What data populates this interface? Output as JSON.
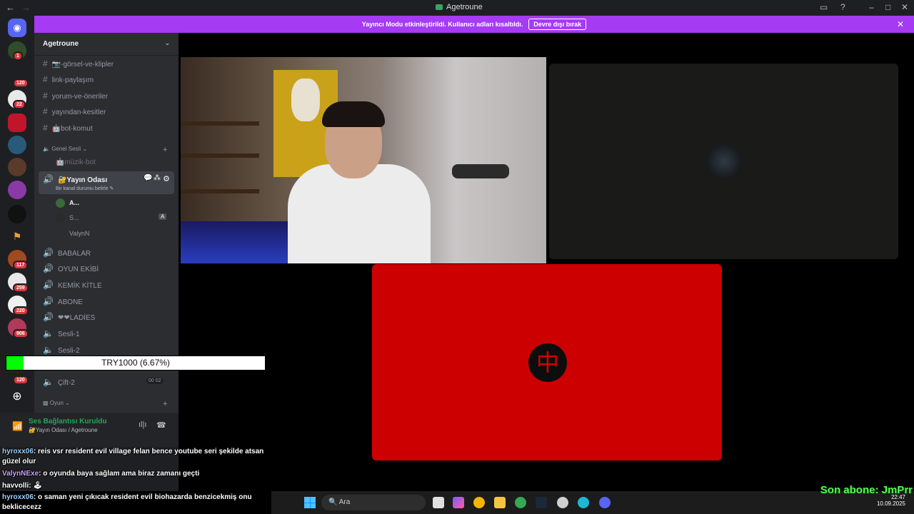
{
  "window": {
    "title": "Agetroune"
  },
  "banner": {
    "message": "Yayıncı Modu etkinleştirildi. Kullanıcı adları kısaltıldı.",
    "button": "Devre dışı bırak"
  },
  "guild_badges": [
    "1",
    "120",
    "22",
    "117",
    "259",
    "220",
    "906",
    "120"
  ],
  "server": {
    "name": "Agetroune"
  },
  "text_channels": [
    "📷-görsel-ve-klipler",
    "link-paylaşım",
    "yorum-ve-öneriler",
    "yayından-kesitler",
    "🤖bot-komut"
  ],
  "category_voice": "Genel Sesli",
  "voice_channels": {
    "muzik": "🤖müzik-bot",
    "active": "🔐Yayın Odası",
    "active_status": "Bir kanal durumu belirle",
    "members": [
      "A...",
      "S...",
      "ValynN"
    ],
    "others": [
      "BABALAR",
      "OYUN EKİBİ",
      "KEMİK KİTLE",
      "ABONE",
      "❤❤LADİES",
      "Sesli-1",
      "Sesli-2",
      "Çift-2"
    ],
    "cift_counts": [
      "00",
      "02"
    ]
  },
  "category_game": "Oyun",
  "voice_status": {
    "title": "Ses Bağlantısı Kuruldu",
    "subtitle": "🔐Yayın Odası / Agetroune"
  },
  "donation": {
    "label": "TRY1000 (6.67%)",
    "percent": 6.67
  },
  "chat": [
    {
      "user": "hyroxx06",
      "text": ": reis vsr resident evil village felan bence youtube seri şekilde atsan güzel olur"
    },
    {
      "user": "ValynNExe",
      "text": ": o oyunda baya sağlam ama biraz zamanı geçti"
    },
    {
      "user": "havvolli",
      "text": ": 🕹"
    },
    {
      "user": "hyroxx06",
      "text": ": o saman yeni çıkıcak resident evil biohazarda benzicekmiş onu beklicecezz"
    }
  ],
  "taskbar": {
    "search_placeholder": "Ara"
  },
  "tray": {
    "time": "22:47",
    "date": "10.09.2025"
  },
  "overlay": {
    "son_abone": "Son abone: JmPrr"
  },
  "colors": {
    "banner": "#a53bf3",
    "cam3_bg": "#cc0000",
    "donation_fill": "#00ff00"
  }
}
